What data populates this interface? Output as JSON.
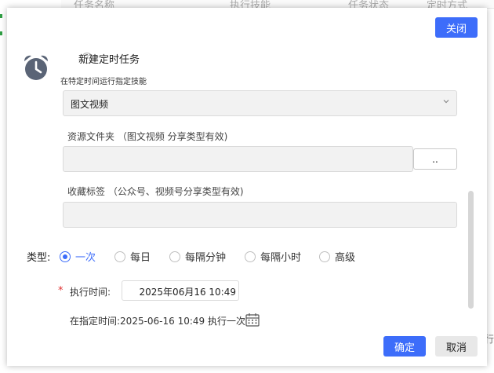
{
  "background": {
    "header_columns": [
      "任务名称",
      "执行技能",
      "任务状态",
      "定时方式"
    ],
    "right_fragment": "行"
  },
  "dialog": {
    "close_label": "关闭",
    "title": "新建定时任务",
    "subtitle": "在特定时间运行指定技能",
    "skill_select": {
      "value": "图文视频"
    },
    "resource_folder": {
      "label": "资源文件夹 （图文视频 分享类型有效)",
      "value": "",
      "browse_label": ".."
    },
    "favorite_tag": {
      "label": "收藏标签 （公众号、视频号分享类型有效)",
      "value": ""
    },
    "type": {
      "label": "类型:",
      "options": [
        "一次",
        "每日",
        "每隔分钟",
        "每隔小时",
        "高级"
      ],
      "selected": "一次"
    },
    "exec_time": {
      "required_mark": "*",
      "label": "执行时间:",
      "value": "2025年06月16 10:49"
    },
    "summary": "在指定时间:2025-06-16 10:49 执行一次",
    "confirm_label": "确定",
    "cancel_label": "取消"
  },
  "colors": {
    "primary": "#3d6dfa",
    "field_bg": "#f2f2f2",
    "required": "#e03131"
  },
  "icons": [
    "alarm-clock-icon",
    "help-icon",
    "chevron-down-icon",
    "calendar-icon"
  ]
}
